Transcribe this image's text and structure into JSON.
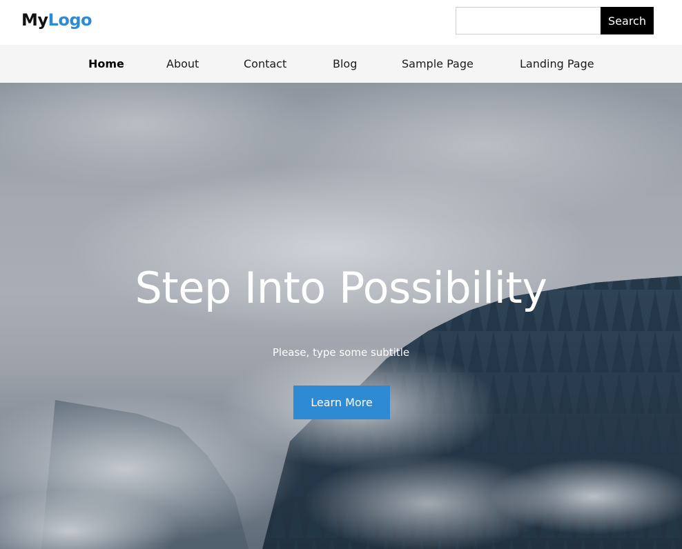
{
  "header": {
    "logo_part1": "My",
    "logo_part2": "Logo",
    "search": {
      "value": "",
      "placeholder": "",
      "button_label": "Search"
    }
  },
  "nav": {
    "items": [
      {
        "label": "Home",
        "active": true
      },
      {
        "label": "About"
      },
      {
        "label": "Contact"
      },
      {
        "label": "Blog"
      },
      {
        "label": "Sample Page"
      },
      {
        "label": "Landing Page"
      }
    ]
  },
  "hero": {
    "title": "Step Into Possibility",
    "subtitle": "Please, type some subtitle",
    "button_label": "Learn More"
  },
  "colors": {
    "brand": "#2e8bd3",
    "search_button": "#000000",
    "nav_background": "#f5f5f5"
  }
}
